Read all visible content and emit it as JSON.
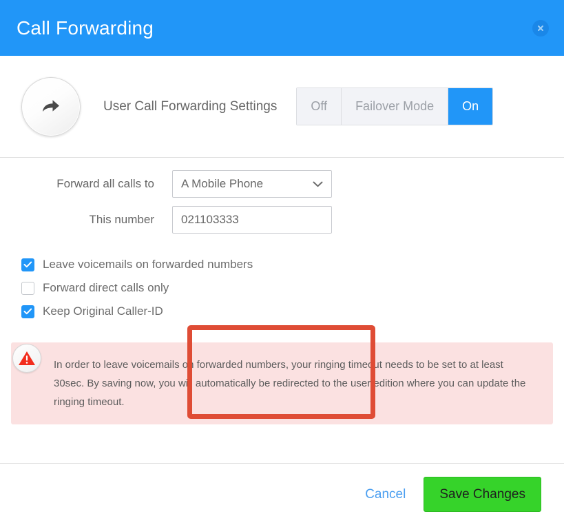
{
  "header": {
    "title": "Call Forwarding",
    "close_icon": "close-icon"
  },
  "settings": {
    "icon": "forward-arrow-icon",
    "label": "User Call Forwarding Settings",
    "toggle": {
      "options": [
        "Off",
        "Failover Mode",
        "On"
      ],
      "selected": "On",
      "active_color": "#2196f8",
      "inactive_bg": "#f2f3f7"
    }
  },
  "form": {
    "forward_to": {
      "label": "Forward all calls to",
      "value": "A Mobile Phone",
      "chevron_icon": "chevron-down-icon"
    },
    "number": {
      "label": "This number",
      "value": "021103333",
      "placeholder": ""
    },
    "annotation_color": "#df4c35"
  },
  "checkboxes": [
    {
      "label": "Leave voicemails on forwarded numbers",
      "checked": true
    },
    {
      "label": "Forward direct calls only",
      "checked": false
    },
    {
      "label": "Keep Original Caller-ID",
      "checked": true
    }
  ],
  "warning": {
    "icon": "warning-triangle-icon",
    "text": "In order to leave voicemails on forwarded numbers, your ringing timeout needs to be set to at least 30sec. By saving now, you will automatically be redirected to the user edition where you can update the ringing timeout.",
    "background_color": "#fbe1e1",
    "icon_color": "#f22d1d"
  },
  "footer": {
    "cancel_label": "Cancel",
    "cancel_color": "#4a9ef0",
    "save_label": "Save Changes",
    "save_color": "#36d32a"
  }
}
